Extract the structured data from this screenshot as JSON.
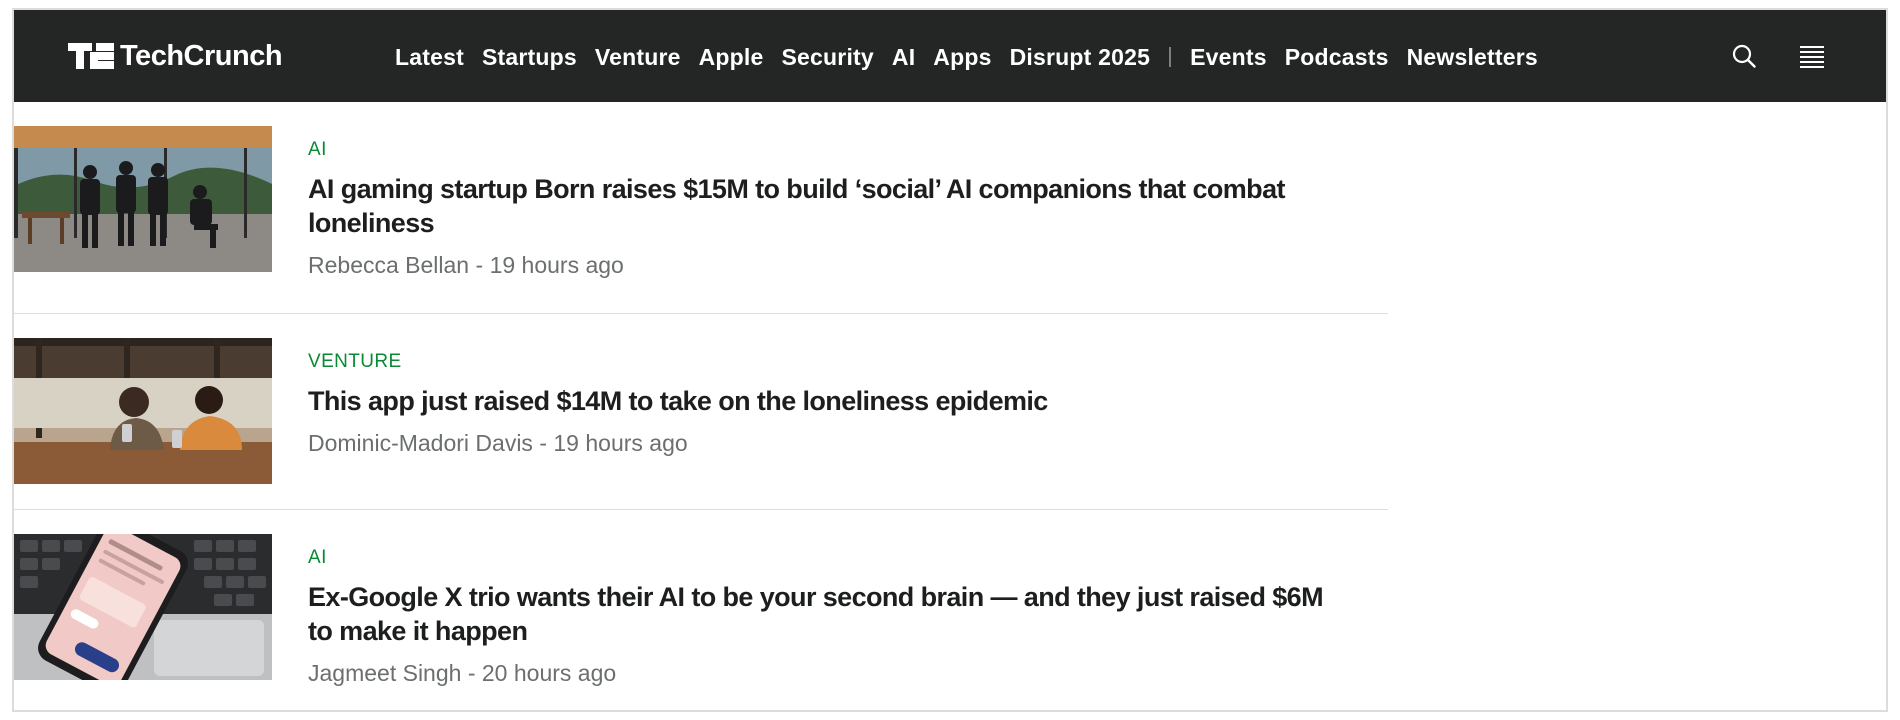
{
  "nav": {
    "logo_text": "TechCrunch",
    "items": [
      "Latest",
      "Startups",
      "Venture",
      "Apple",
      "Security",
      "AI",
      "Apps",
      "Disrupt 2025"
    ],
    "items_after_separator": [
      "Events",
      "Podcasts",
      "Newsletters"
    ],
    "search_icon": "search-icon",
    "menu_icon": "hamburger-menu-icon",
    "background_color": "#232624"
  },
  "articles": [
    {
      "category": "AI",
      "headline": "AI gaming startup Born raises $15M to build ‘social’ AI companions that combat loneliness",
      "author": "Rebecca Bellan",
      "time": "19 hours ago"
    },
    {
      "category": "VENTURE",
      "headline": "This app just raised $14M to take on the loneliness epidemic",
      "author": "Dominic-Madori Davis",
      "time": "19 hours ago"
    },
    {
      "category": "AI",
      "headline": "Ex-Google X trio wants their AI to be your second brain — and they just raised $6M to make it happen",
      "author": "Jagmeet Singh",
      "time": "20 hours ago"
    }
  ],
  "meta_separator": " - ",
  "colors": {
    "category": "#0a8935",
    "meta": "#6b6f6d",
    "divider": "#dedede"
  }
}
